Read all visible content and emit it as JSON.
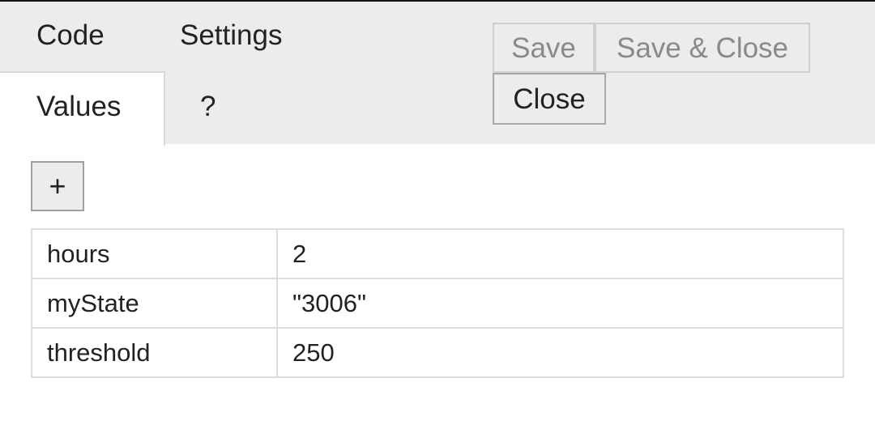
{
  "tabs": {
    "code": "Code",
    "settings": "Settings",
    "values": "Values",
    "help": "?"
  },
  "toolbar": {
    "save_label": "Save",
    "save_close_label": "Save & Close",
    "close_label": "Close",
    "add_label": "+"
  },
  "values": [
    {
      "key": "hours",
      "value": "2"
    },
    {
      "key": "myState",
      "value": "\"3006\""
    },
    {
      "key": "threshold",
      "value": "250"
    }
  ],
  "colors": {
    "header_bg": "#ececec",
    "disabled_text": "#8a8a8a",
    "text": "#222222"
  }
}
